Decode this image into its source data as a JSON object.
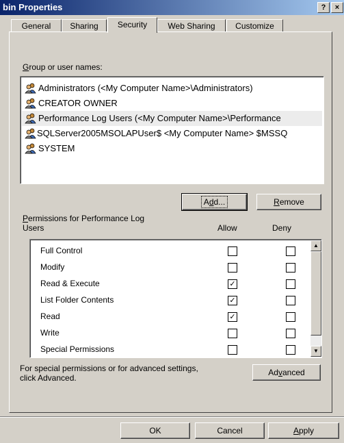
{
  "window": {
    "title": "bin Properties",
    "help_glyph": "?",
    "close_glyph": "×"
  },
  "tabs": [
    {
      "label": "General"
    },
    {
      "label": "Sharing"
    },
    {
      "label": "Security",
      "active": true
    },
    {
      "label": "Web Sharing"
    },
    {
      "label": "Customize"
    }
  ],
  "groups": {
    "label_prefix": "",
    "label_acc": "G",
    "label_rest": "roup or user names:",
    "items": [
      {
        "name": "Administrators (<My Computer Name>\\Administrators)",
        "icon": "users-group-icon"
      },
      {
        "name": "CREATOR OWNER",
        "icon": "users-group-icon"
      },
      {
        "name": "Performance Log Users (<My Computer Name>\\Performance",
        "icon": "users-group-icon",
        "selected": true
      },
      {
        "name": "SQLServer2005MSOLAPUser$ <My Computer Name> $MSSQ",
        "icon": "users-group-icon"
      },
      {
        "name": "SYSTEM",
        "icon": "users-group-icon"
      }
    ]
  },
  "buttons": {
    "add_pre": "A",
    "add_acc": "d",
    "add_post": "d...",
    "remove_acc": "R",
    "remove_post": "emove",
    "advanced_pre": "Ad",
    "advanced_acc": "v",
    "advanced_post": "anced",
    "ok": "OK",
    "cancel": "Cancel",
    "apply_acc": "A",
    "apply_post": "pply"
  },
  "permissions": {
    "label_acc": "P",
    "label_line1_rest": "ermissions for Performance Log",
    "label_line2": "Users",
    "allow_header": "Allow",
    "deny_header": "Deny",
    "rows": [
      {
        "name": "Full Control",
        "allow": false,
        "deny": false
      },
      {
        "name": "Modify",
        "allow": false,
        "deny": false
      },
      {
        "name": "Read & Execute",
        "allow": true,
        "deny": false
      },
      {
        "name": "List Folder Contents",
        "allow": true,
        "deny": false
      },
      {
        "name": "Read",
        "allow": true,
        "deny": false
      },
      {
        "name": "Write",
        "allow": false,
        "deny": false
      },
      {
        "name": "Special Permissions",
        "allow": false,
        "deny": false
      }
    ],
    "check_glyph": "✓"
  },
  "advanced_hint": {
    "line1": "For special permissions or for advanced settings,",
    "line2": "click Advanced."
  },
  "colors": {
    "titlebar_start": "#0a246a",
    "titlebar_end": "#a6caf0",
    "dialog_face": "#d4d0c8",
    "selected_row": "#ececec"
  }
}
